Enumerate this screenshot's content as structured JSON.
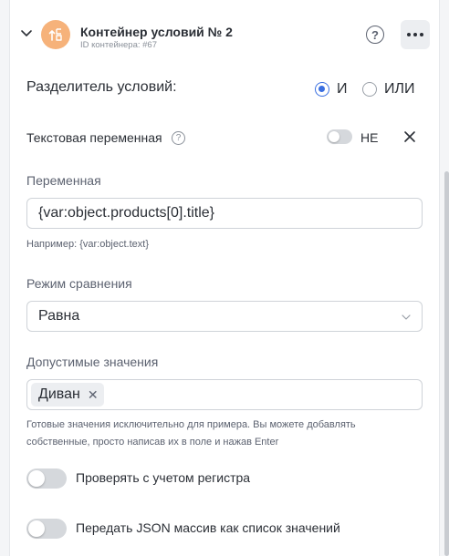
{
  "header": {
    "title": "Контейнер условий № 2",
    "subtitle": "ID контейнера: #67",
    "help_glyph": "?",
    "icons": {
      "collapse": "chevron-down-icon",
      "avatar": "condition-branch-icon",
      "more": "more-horizontal-icon"
    },
    "avatar_color": "#f6b27a"
  },
  "separator": {
    "label": "Разделитель условий:",
    "options": [
      {
        "label": "И",
        "selected": true
      },
      {
        "label": "ИЛИ",
        "selected": false
      }
    ],
    "accent_color": "#3a6fe0"
  },
  "text_variable": {
    "label": "Текстовая переменная",
    "help_glyph": "?",
    "not_label": "НЕ",
    "not_enabled": false
  },
  "variable": {
    "label": "Переменная",
    "value": "{var:object.products[0].title}",
    "hint": "Например: {var:object.text}"
  },
  "compare_mode": {
    "label": "Режим сравнения",
    "selected": "Равна"
  },
  "allowed_values": {
    "label": "Допустимые значения",
    "chips": [
      "Диван"
    ],
    "hint_line1": "Готовые значения исключительно для примера. Вы можете добавлять",
    "hint_line2": "собственные, просто написав их в поле и нажав Enter"
  },
  "switches": [
    {
      "label": "Проверять с учетом регистра",
      "enabled": false
    },
    {
      "label": "Передать JSON массив как список значений",
      "enabled": false
    }
  ]
}
